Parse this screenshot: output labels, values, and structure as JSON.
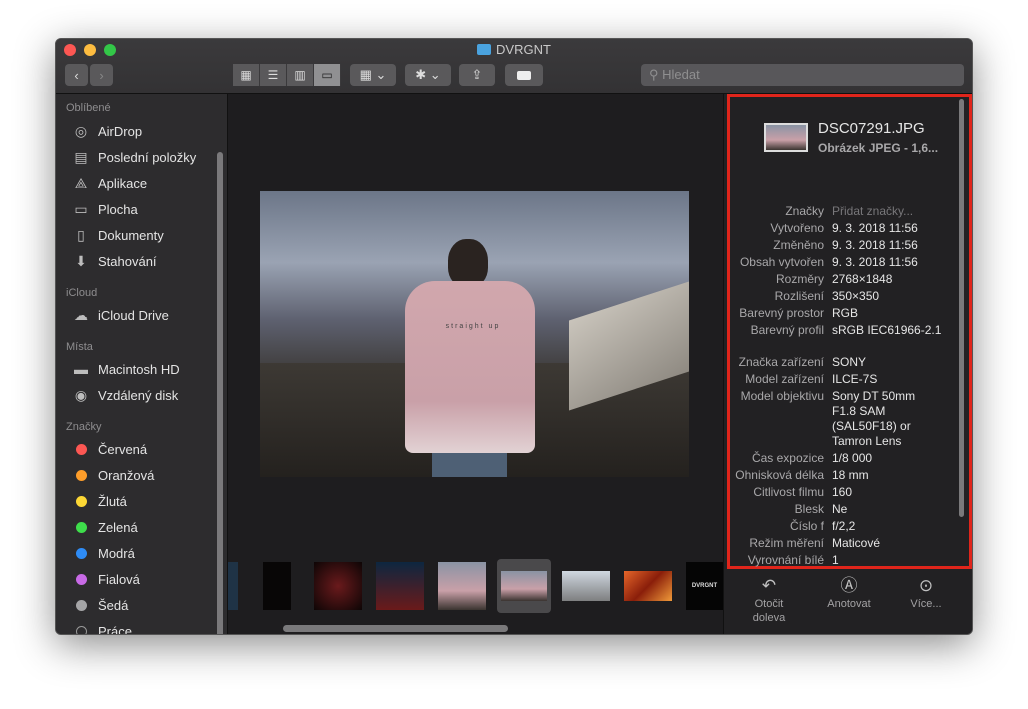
{
  "window": {
    "title": "DVRGNT"
  },
  "toolbar": {
    "search_placeholder": "Hledat"
  },
  "sidebar": {
    "sections": [
      {
        "title": "Oblíbené",
        "items": [
          {
            "label": "AirDrop",
            "icon": "airdrop-icon"
          },
          {
            "label": "Poslední položky",
            "icon": "recents-icon"
          },
          {
            "label": "Aplikace",
            "icon": "applications-icon"
          },
          {
            "label": "Plocha",
            "icon": "desktop-icon"
          },
          {
            "label": "Dokumenty",
            "icon": "documents-icon"
          },
          {
            "label": "Stahování",
            "icon": "downloads-icon"
          }
        ]
      },
      {
        "title": "iCloud",
        "items": [
          {
            "label": "iCloud Drive",
            "icon": "cloud-icon"
          }
        ]
      },
      {
        "title": "Místa",
        "items": [
          {
            "label": "Macintosh HD",
            "icon": "disk-icon"
          },
          {
            "label": "Vzdálený disk",
            "icon": "remote-disc-icon"
          }
        ]
      },
      {
        "title": "Značky",
        "items": [
          {
            "label": "Červená",
            "color": "#fc5753"
          },
          {
            "label": "Oranžová",
            "color": "#fd9d2a"
          },
          {
            "label": "Žlutá",
            "color": "#fdd835"
          },
          {
            "label": "Zelená",
            "color": "#3ede4b"
          },
          {
            "label": "Modrá",
            "color": "#2e8cf6"
          },
          {
            "label": "Fialová",
            "color": "#c86ae6"
          },
          {
            "label": "Šedá",
            "color": "#a5a5a7"
          },
          {
            "label": "Práce",
            "color": "none"
          }
        ]
      }
    ]
  },
  "preview": {
    "photo_text": "straight up"
  },
  "inspector": {
    "file_name": "DSC07291.JPG",
    "file_kind": "Obrázek JPEG - 1,6...",
    "rows": [
      {
        "k": "Značky",
        "v": "Přidat značky..."
      },
      {
        "k": "Vytvořeno",
        "v": "9. 3. 2018 11:56"
      },
      {
        "k": "Změněno",
        "v": "9. 3. 2018 11:56"
      },
      {
        "k": "Obsah vytvořen",
        "v": "9. 3. 2018 11:56"
      },
      {
        "k": "Rozměry",
        "v": "2768×1848"
      },
      {
        "k": "Rozlišení",
        "v": "350×350"
      },
      {
        "k": "Barevný prostor",
        "v": "RGB"
      },
      {
        "k": "Barevný profil",
        "v": "sRGB IEC61966-2.1"
      },
      {
        "k": "Značka zařízení",
        "v": "SONY"
      },
      {
        "k": "Model zařízení",
        "v": "ILCE-7S"
      },
      {
        "k": "Model objektivu",
        "v": "Sony DT 50mm F1.8 SAM (SAL50F18) or Tamron Lens"
      },
      {
        "k": "Čas expozice",
        "v": "1/8 000"
      },
      {
        "k": "Ohnisková délka",
        "v": "18 mm"
      },
      {
        "k": "Citlivost filmu",
        "v": "160"
      },
      {
        "k": "Blesk",
        "v": "Ne"
      },
      {
        "k": "Číslo f",
        "v": "f/2,2"
      },
      {
        "k": "Režim měření",
        "v": "Maticové"
      },
      {
        "k": "Vyrovnání bílé",
        "v": "1"
      }
    ],
    "actions": [
      {
        "label": "Otočit doleva",
        "icon": "rotate-left-icon"
      },
      {
        "label": "Anotovat",
        "icon": "markup-icon"
      },
      {
        "label": "Více...",
        "icon": "more-icon"
      }
    ]
  },
  "thumbnail_label": "DVRGNT"
}
